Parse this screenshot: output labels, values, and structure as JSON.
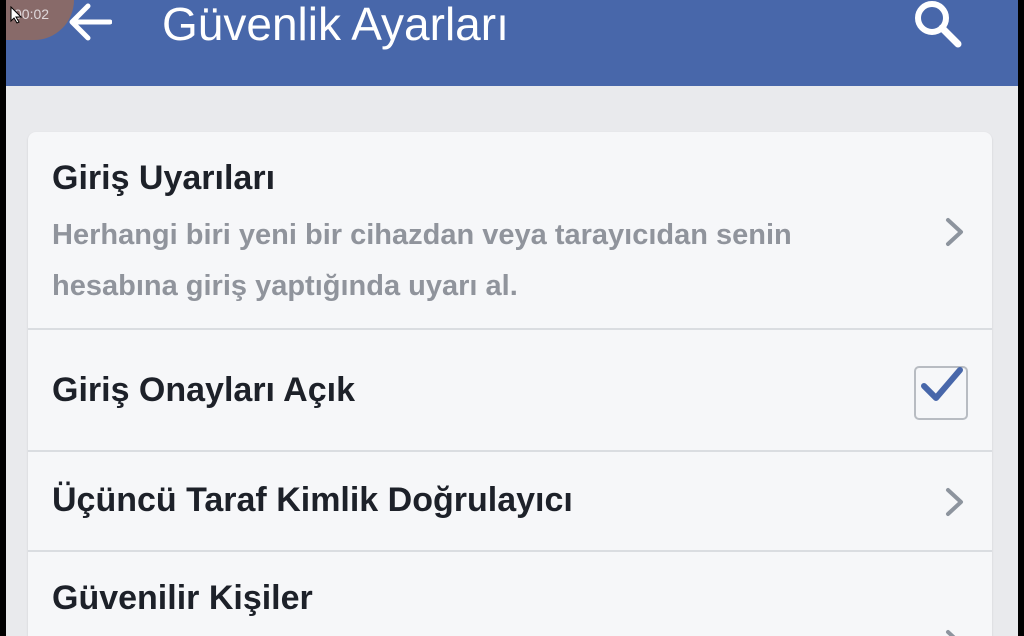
{
  "overlay": {
    "timer": "00:02"
  },
  "appbar": {
    "title": "Güvenlik Ayarları",
    "back_icon": "back-arrow-icon",
    "search_icon": "search-icon",
    "color": "#4867aa"
  },
  "settings": {
    "items": [
      {
        "title": "Giriş Uyarıları",
        "description": "Herhangi biri yeni bir cihazdan veya tarayıcıdan senin hesabına giriş yaptığında uyarı al.",
        "control": "chevron-right-icon"
      },
      {
        "title": "Giriş Onayları Açık",
        "control": "checkbox",
        "checked": true
      },
      {
        "title": "Üçüncü Taraf Kimlik Doğrulayıcı",
        "control": "chevron-right-icon"
      },
      {
        "title": "Güvenilir Kişiler",
        "control": "chevron-right-icon"
      }
    ]
  },
  "colors": {
    "check": "#4867aa",
    "title_text": "#1d2129",
    "description_text": "#90949c"
  }
}
